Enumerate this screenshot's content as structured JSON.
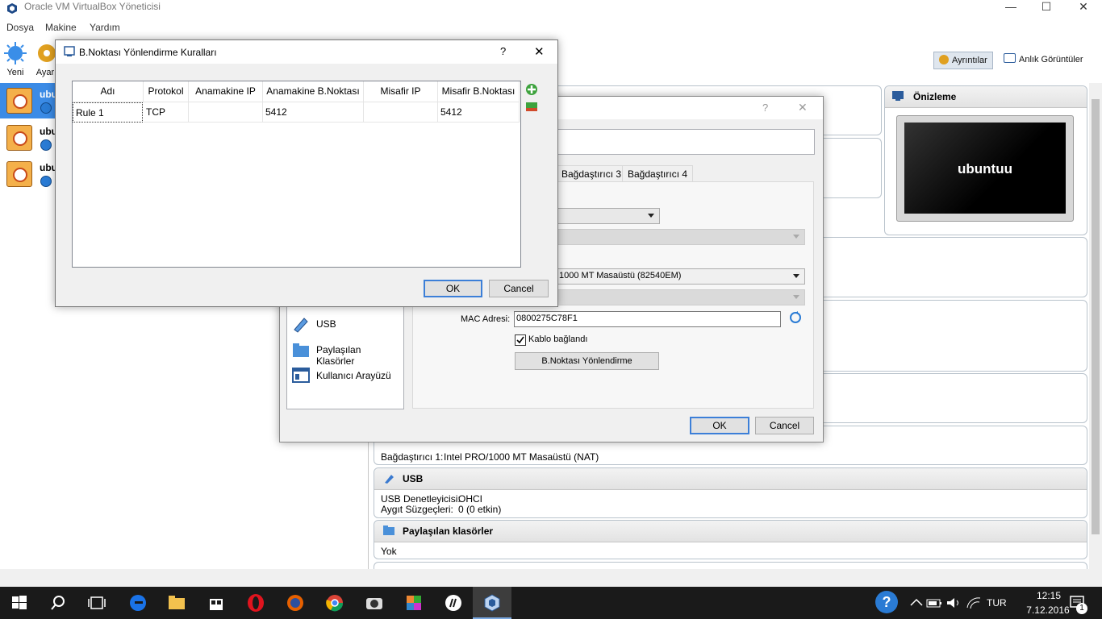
{
  "window": {
    "title": "Oracle VM VirtualBox Yöneticisi",
    "min": "—",
    "max": "☐",
    "close": "✕"
  },
  "menu": [
    "Dosya",
    "Makine",
    "Yardım"
  ],
  "toolbar": {
    "new_label": "Yeni",
    "settings_label": "Ayar",
    "details_label": "Ayrıntılar",
    "snapshots_label": "Anlık Görüntüler"
  },
  "vms": [
    {
      "name": "ubu",
      "selected": true
    },
    {
      "name": "ubu",
      "selected": false
    },
    {
      "name": "ubu",
      "selected": false
    }
  ],
  "preview": {
    "header": "Önizleme",
    "screen_text": "ubuntuu"
  },
  "details": {
    "network_row": {
      "label": "Bağdaştırıcı 1:",
      "value": "Intel PRO/1000 MT Masaüstü (NAT)"
    },
    "usb": {
      "header": "USB",
      "controller_label": "USB Denetleyicisi:",
      "controller_value": "OHCI",
      "filters_label": "Aygıt Süzgeçleri:",
      "filters_value": "0 (0 etkin)"
    },
    "shared": {
      "header": "Paylaşılan klasörler",
      "value": "Yok"
    }
  },
  "settings_dialog": {
    "help": "?",
    "close": "✕",
    "tabs": [
      "Bağdaştırıcı 3",
      "Bağdaştırıcı 4"
    ],
    "adapter_type": "1000 MT Masaüstü (82540EM)",
    "mac_label": "MAC Adresi:",
    "mac_value": "0800275C78F1",
    "cable_label": "Kablo bağlandı",
    "port_forward_label": "B.Noktası Yönlendirme",
    "sidebar": [
      "USB",
      "Paylaşılan Klasörler",
      "Kullanıcı Arayüzü"
    ],
    "ok": "OK",
    "cancel": "Cancel"
  },
  "pf_dialog": {
    "title": "B.Noktası Yönlendirme Kuralları",
    "help": "?",
    "close": "✕",
    "columns": [
      "Adı",
      "Protokol",
      "Anamakine IP",
      "Anamakine B.Noktası",
      "Misafir IP",
      "Misafir B.Noktası"
    ],
    "rows": [
      [
        "Rule 1",
        "TCP",
        "",
        "5412",
        "",
        "5412"
      ]
    ],
    "ok": "OK",
    "cancel": "Cancel"
  },
  "taskbar": {
    "lang": "TUR",
    "time": "12:15",
    "date": "7.12.2016",
    "notif_count": "1"
  },
  "colors": {
    "selection": "#3b8be6",
    "taskbar": "#1a1a1a",
    "accent": "#3c7fd8"
  }
}
